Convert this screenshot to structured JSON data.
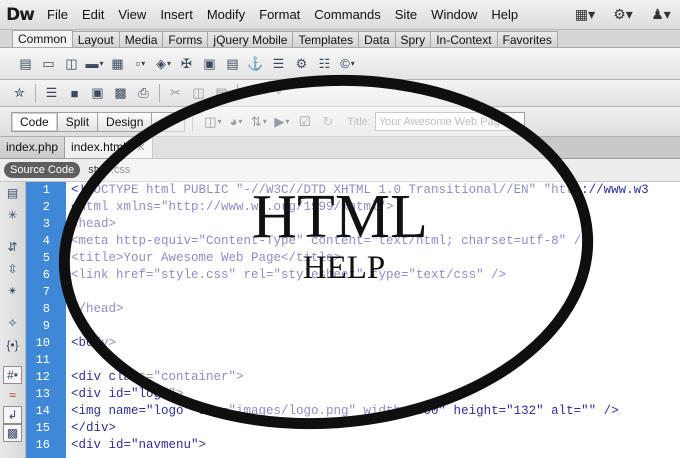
{
  "app": {
    "logo": "Dw"
  },
  "menu": [
    "File",
    "Edit",
    "View",
    "Insert",
    "Modify",
    "Format",
    "Commands",
    "Site",
    "Window",
    "Help"
  ],
  "menubar_icons": [
    "layout-icon",
    "gear-icon",
    "user-icon"
  ],
  "insert_tabs": [
    "Common",
    "Layout",
    "Media",
    "Forms",
    "jQuery Mobile",
    "Templates",
    "Data",
    "Spry",
    "In-Context",
    "Favorites"
  ],
  "insert_tabs_active": "Common",
  "view_buttons": [
    "Code",
    "Split",
    "Design"
  ],
  "view_active": "Code",
  "title_label": "Title:",
  "title_value": "Your Awesome Web Page",
  "doc_tabs": [
    {
      "label": "index.php",
      "active": false
    },
    {
      "label": "index.html*",
      "active": true
    }
  ],
  "related": {
    "source": "Source Code",
    "file": "style.css"
  },
  "code_lines": [
    {
      "n": "1",
      "text": "<!DOCTYPE html PUBLIC \"-//W3C//DTD XHTML 1.0 Transitional//EN\" \"http://www.w3"
    },
    {
      "n": "2",
      "text": "<html xmlns=\"http://www.w3.org/1999/xhtml\">"
    },
    {
      "n": "3",
      "text": "<head>"
    },
    {
      "n": "4",
      "text": "<meta http-equiv=\"Content-Type\" content=\"text/html; charset=utf-8\" />"
    },
    {
      "n": "5",
      "text": "<title>Your Awesome Web Page</title>"
    },
    {
      "n": "6",
      "text": "<link href=\"style.css\" rel=\"stylesheet\" type=\"text/css\" />"
    },
    {
      "n": "7",
      "text": ""
    },
    {
      "n": "8",
      "text": "</head>"
    },
    {
      "n": "9",
      "text": ""
    },
    {
      "n": "10",
      "text": "<body>"
    },
    {
      "n": "11",
      "text": ""
    },
    {
      "n": "12",
      "text": "<div class=\"container\">"
    },
    {
      "n": "13",
      "text": "<div id=\"logo\">"
    },
    {
      "n": "14",
      "text": "<img name=\"logo\" src=\"images/logo.png\" width=\"300\" height=\"132\" alt=\"\" />"
    },
    {
      "n": "15",
      "text": "</div>"
    },
    {
      "n": "16",
      "text": "<div id=\"navmenu\">"
    }
  ],
  "overlay": {
    "title": "HTML",
    "subtitle": "HELP"
  },
  "colors": {
    "gutter": "#3e88d7",
    "code_text": "#2e2e9a",
    "toolbar": "#e4e4e4"
  }
}
